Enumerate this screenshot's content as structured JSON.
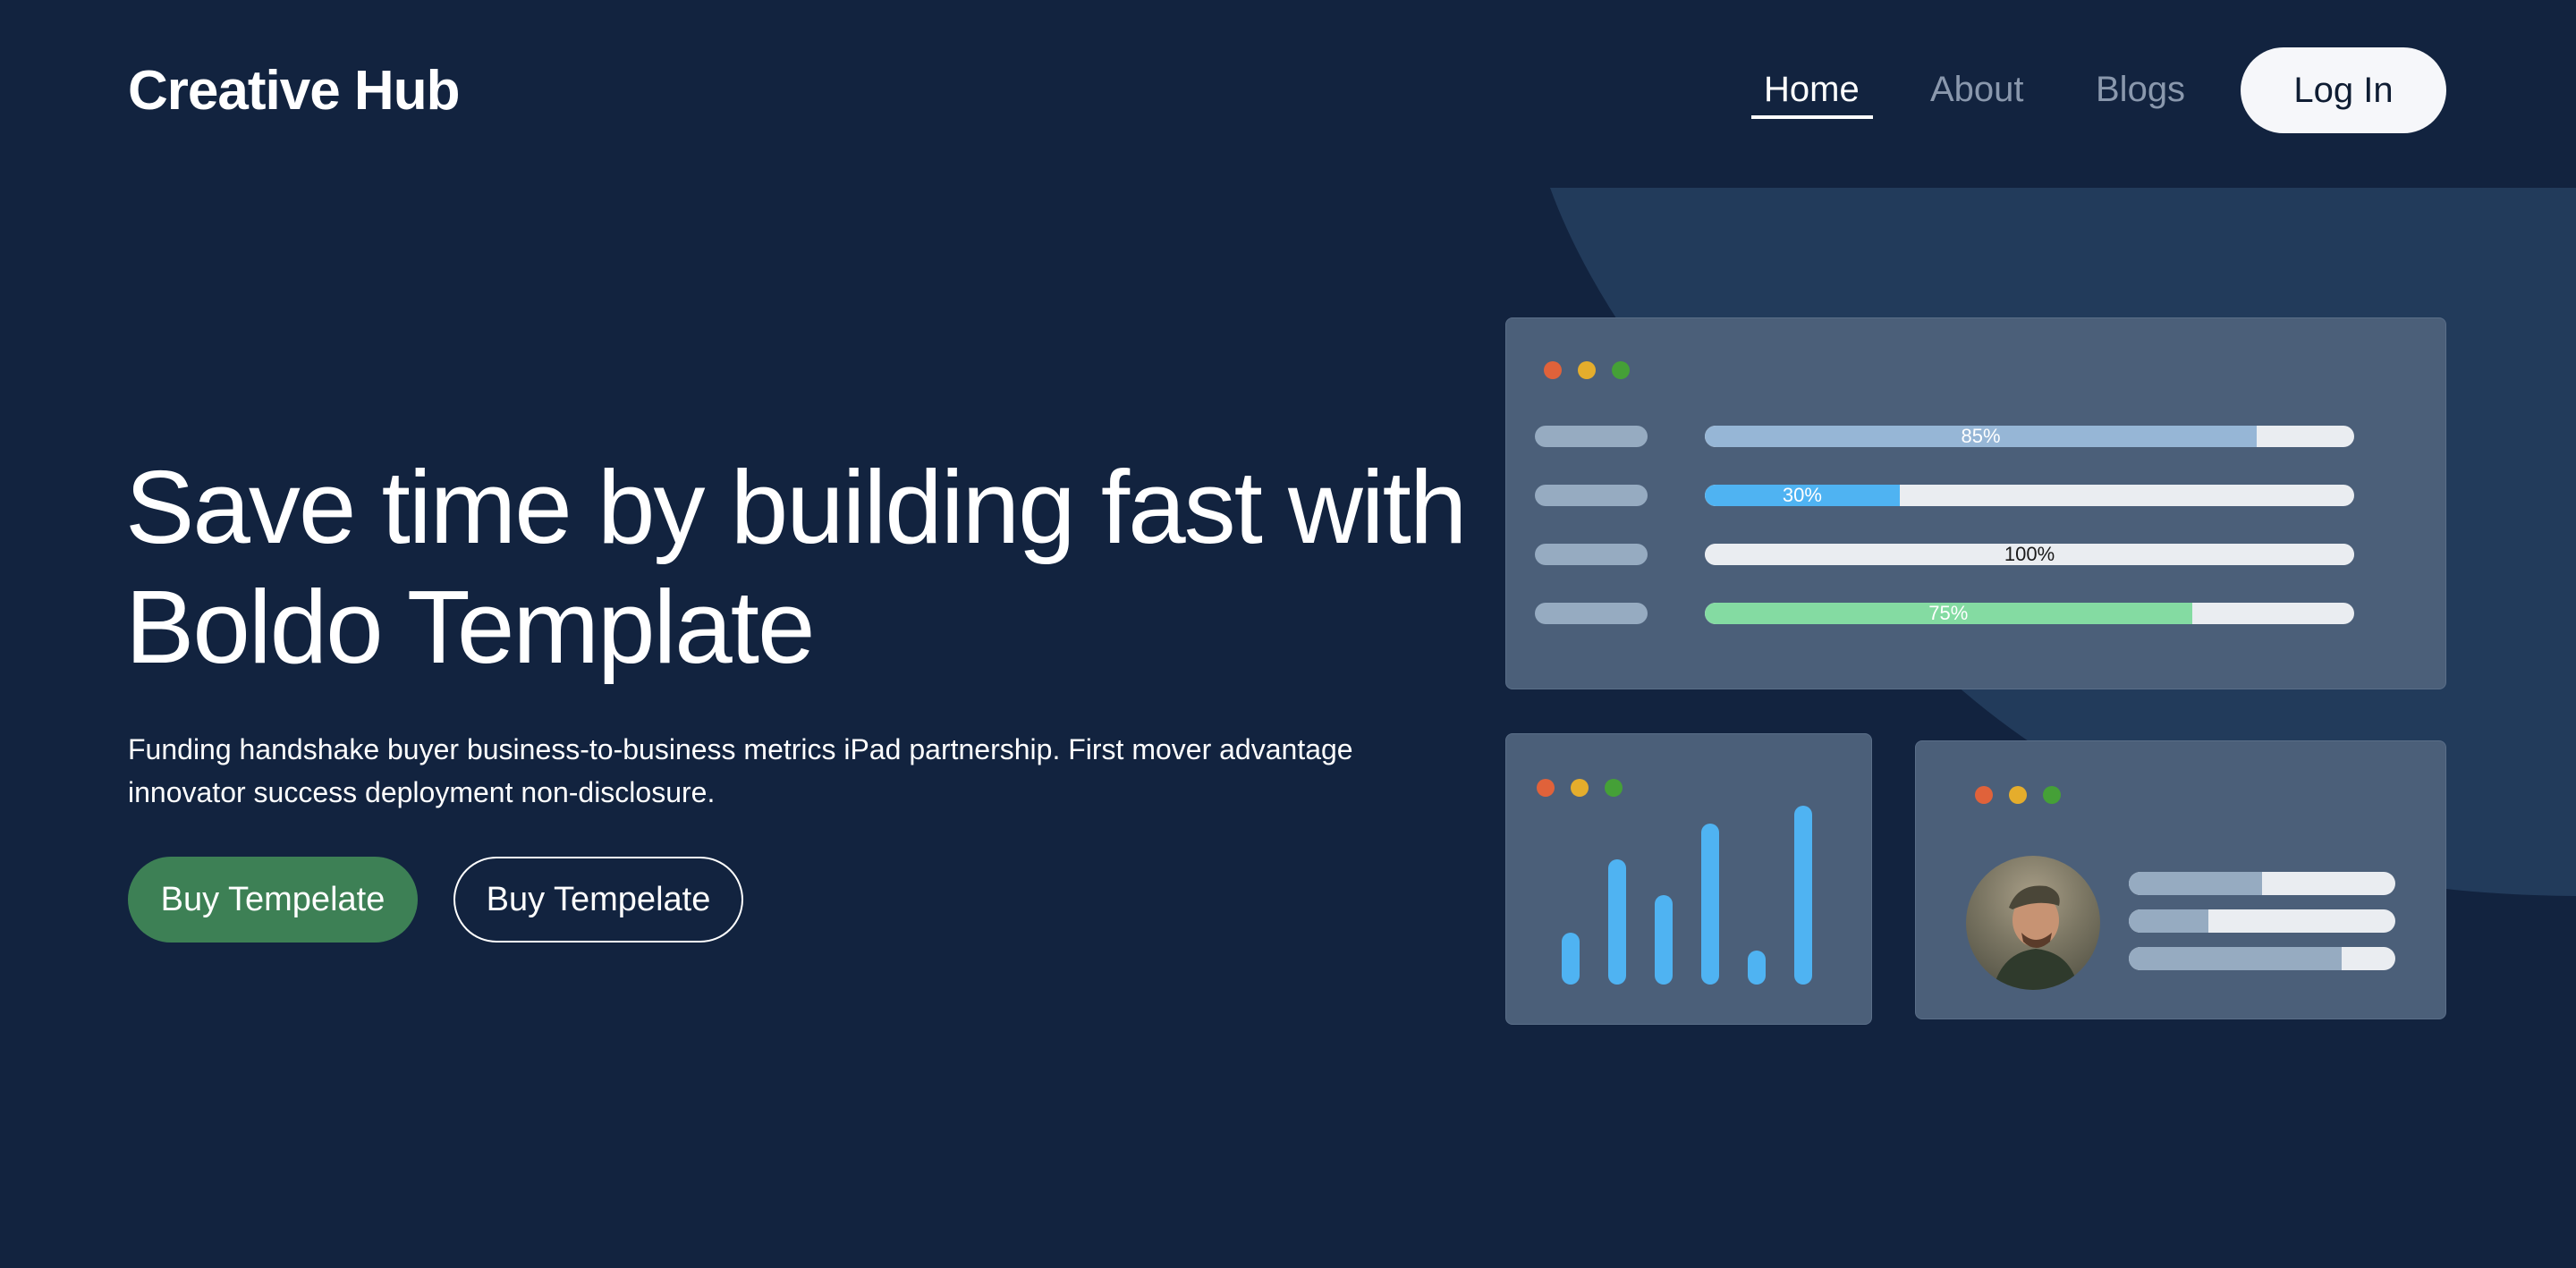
{
  "header": {
    "logo": "Creative Hub",
    "nav": [
      {
        "label": "Home",
        "active": true
      },
      {
        "label": "About",
        "active": false
      },
      {
        "label": "Blogs",
        "active": false
      }
    ],
    "login_label": "Log In"
  },
  "hero": {
    "title_line1": "Save time by building fast with",
    "title_line2": "Boldo Template",
    "description_line1": "Funding handshake buyer business-to-business metrics iPad partnership. First mover advantage",
    "description_line2": "innovator success deployment non-disclosure.",
    "primary_button": "Buy Tempelate",
    "secondary_button": "Buy Tempelate"
  },
  "dashboard": {
    "progress_bars": [
      {
        "label": "85%",
        "value": 0.85,
        "color": "#96b6d6"
      },
      {
        "label": "30%",
        "value": 0.3,
        "color": "#4fb3f2"
      },
      {
        "label": "100%",
        "value": 1.0,
        "color": "#eaedf1"
      },
      {
        "label": "75%",
        "value": 0.75,
        "color": "#84dba2"
      }
    ],
    "column_chart_values": [
      0.29,
      0.7,
      0.5,
      0.9,
      0.19,
      1.0
    ],
    "profile_bars": [
      0.5,
      0.3,
      0.8
    ]
  },
  "colors": {
    "background": "#12233f",
    "accent_green": "#3d8055",
    "card": "#4b5f79",
    "dot_red": "#e0623a",
    "dot_yellow": "#e5ad2c",
    "dot_green": "#45a037"
  }
}
